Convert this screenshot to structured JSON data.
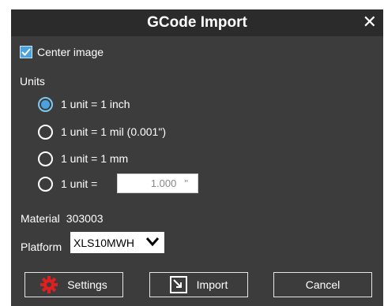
{
  "window": {
    "title": "GCode Import",
    "close_glyph": "✕"
  },
  "center_image": {
    "label": "Center image",
    "checked": true
  },
  "units": {
    "title": "Units",
    "options": [
      {
        "label": "1 unit = 1 inch",
        "selected": true
      },
      {
        "label": "1 unit = 1 mil (0.001\")",
        "selected": false
      },
      {
        "label": "1 unit = 1 mm",
        "selected": false
      },
      {
        "label": "1 unit =",
        "selected": false
      }
    ],
    "custom_value": "1.000",
    "custom_unit": "\""
  },
  "material": {
    "label": "Material",
    "value": "303003"
  },
  "platform": {
    "label": "Platform",
    "selected": "XLS10MWH"
  },
  "buttons": {
    "settings": "Settings",
    "import": "Import",
    "cancel": "Cancel"
  },
  "colors": {
    "accent": "#4aa3df",
    "dialog_bg": "#3c3c3c",
    "titlebar_bg": "#2b2b2b",
    "settings_icon": "#e02020"
  },
  "icons": {
    "settings": "gear-icon",
    "import": "import-icon",
    "close": "close-icon",
    "dropdown": "chevron-down-icon"
  }
}
